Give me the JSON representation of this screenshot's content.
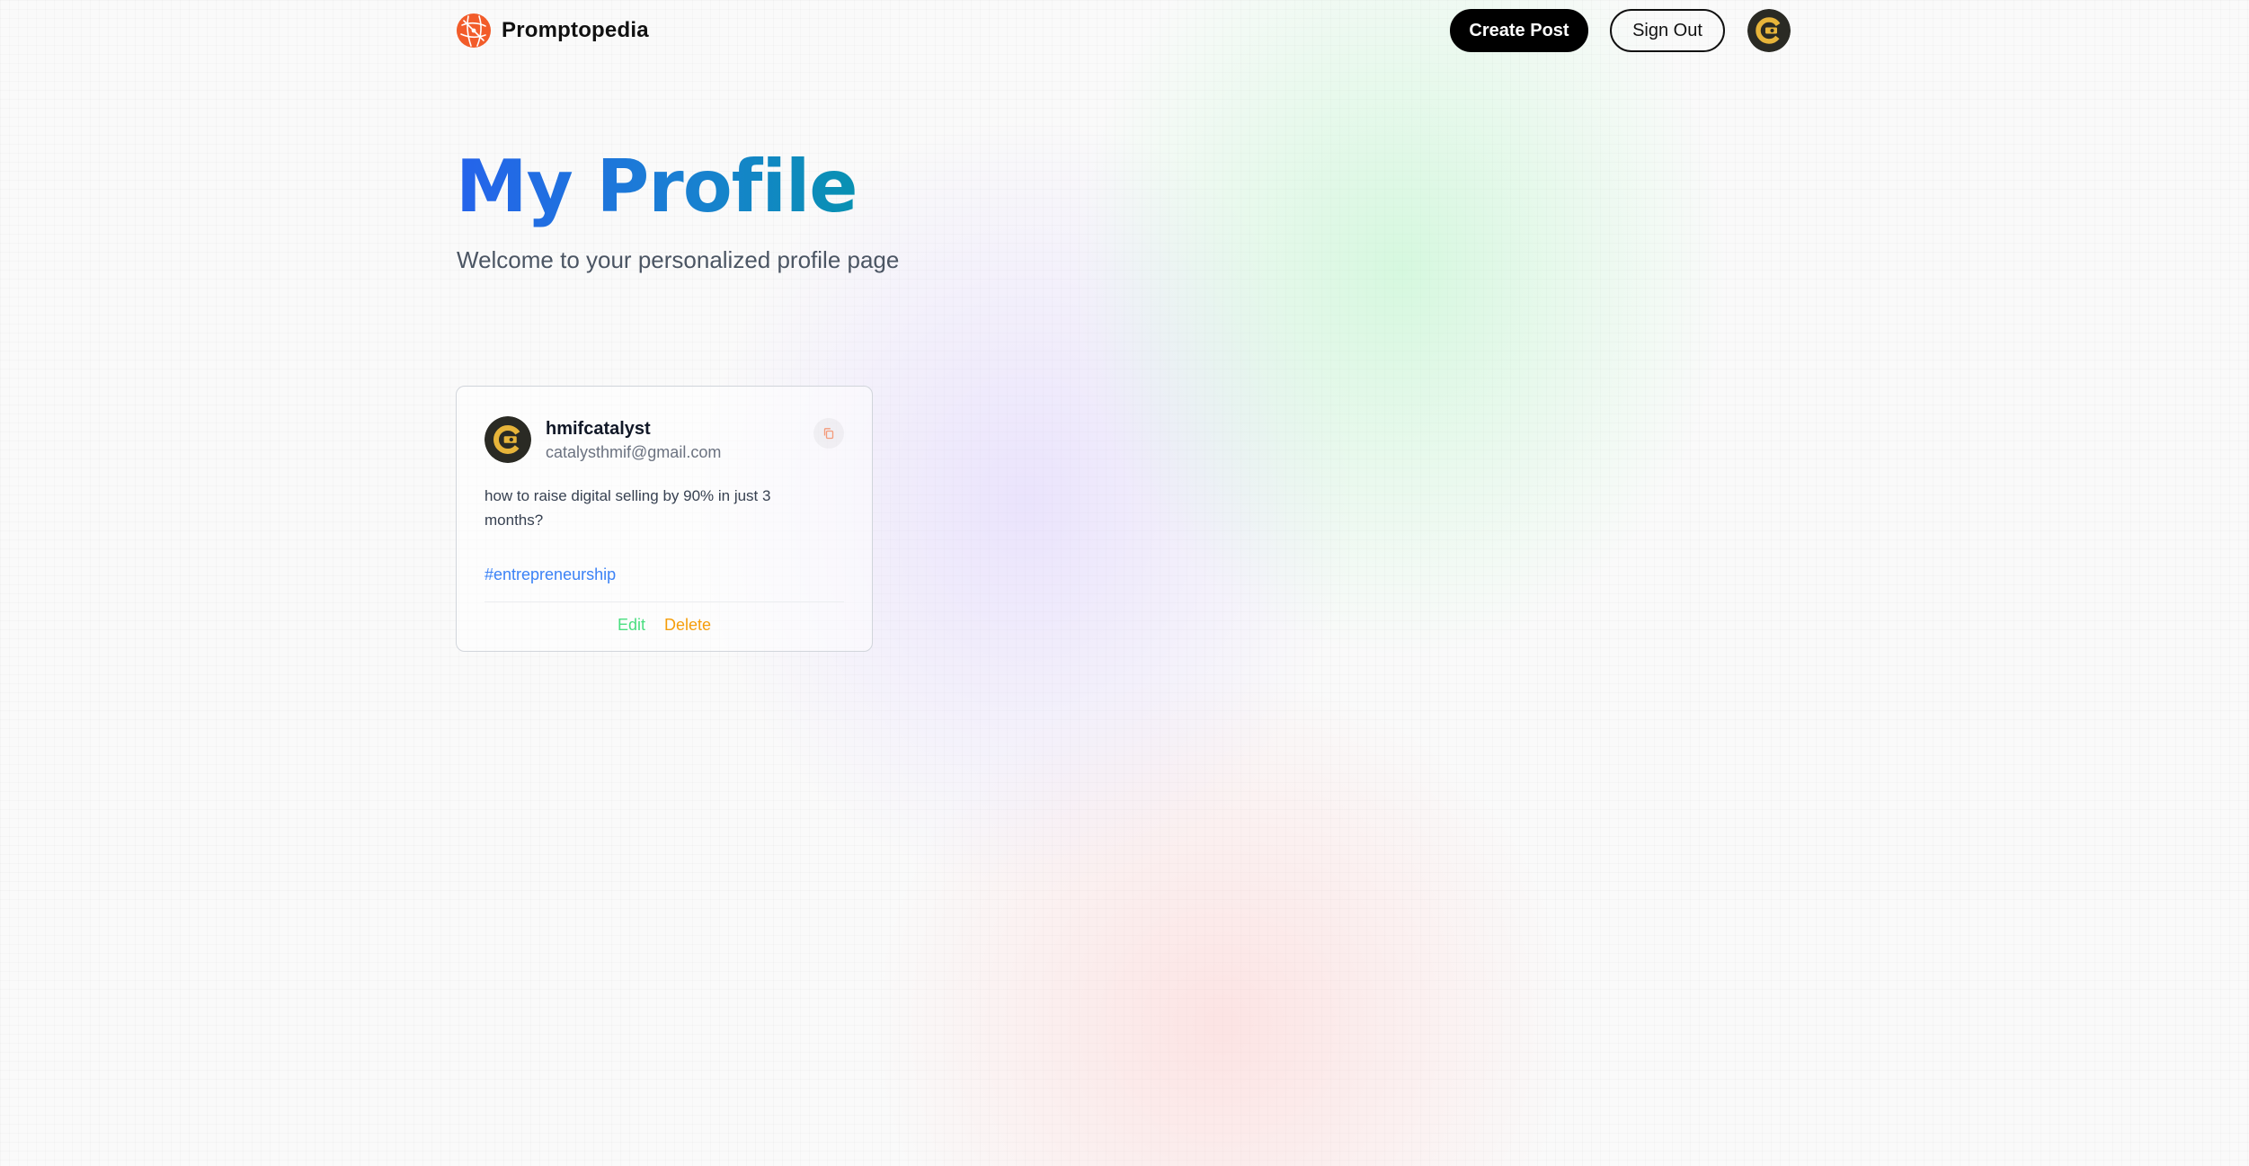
{
  "nav": {
    "brand_name": "Promptopedia",
    "brand_logo_icon": "globe-network-logo",
    "brand_color": "#f25c2a",
    "create_post_label": "Create Post",
    "sign_out_label": "Sign Out",
    "user_avatar_icon": "user-avatar"
  },
  "profile": {
    "title": "My Profile",
    "subtitle": "Welcome to your personalized profile page"
  },
  "posts": [
    {
      "username": "hmifcatalyst",
      "email": "catalysthmif@gmail.com",
      "prompt": "how to raise digital selling by 90% in just 3 months?",
      "tag": "#entrepreneurship",
      "copy_icon": "copy-icon",
      "edit_label": "Edit",
      "delete_label": "Delete"
    }
  ],
  "colors": {
    "title_gradient_start": "#2563eb",
    "title_gradient_end": "#0891b2",
    "tag": "#3b82f6",
    "edit": "#4ade80",
    "delete": "#f59e0b"
  }
}
